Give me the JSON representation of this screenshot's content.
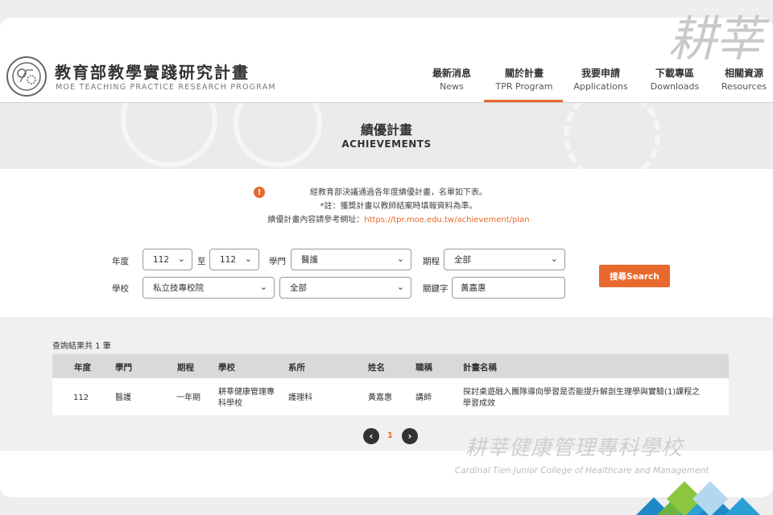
{
  "watermark_top": "耕莘",
  "logo": {
    "zh": "教育部教學實踐研究計畫",
    "en": "MOE TEACHING PRACTICE RESEARCH PROGRAM"
  },
  "nav": [
    {
      "zh": "最新消息",
      "en": "News"
    },
    {
      "zh": "關於計畫",
      "en": "TPR Program"
    },
    {
      "zh": "我要申請",
      "en": "Applications"
    },
    {
      "zh": "下載專區",
      "en": "Downloads"
    },
    {
      "zh": "相關資源",
      "en": "Resources"
    }
  ],
  "banner": {
    "zh": "績優計畫",
    "en": "ACHIEVEMENTS"
  },
  "notice": {
    "icon": "!",
    "line1": "經教育部決議通過各年度績優計畫，名單如下表。",
    "line2": "*註：獲獎計畫以教師結案時填報資料為準。",
    "line3_prefix": "績優計畫內容請參考網址：",
    "line3_link": "https://tpr.moe.edu.tw/achievement/plan"
  },
  "filters": {
    "year_label": "年度",
    "year_from": "112",
    "to_label": "至",
    "year_to": "112",
    "dept_label": "學門",
    "dept_value": "醫護",
    "term_label": "期程",
    "term_value": "全部",
    "school_label": "學校",
    "school_type": "私立技專校院",
    "school_value": "全部",
    "keyword_label": "關鍵字",
    "keyword_value": "黃嘉惠",
    "search_button": "搜尋Search"
  },
  "results": {
    "count_text": "查詢結果共 1 筆",
    "headers": [
      "年度",
      "學門",
      "期程",
      "學校",
      "系所",
      "姓名",
      "職稱",
      "計畫名稱"
    ],
    "rows": [
      {
        "year": "112",
        "dept": "醫護",
        "term": "一年期",
        "school_l1": "耕莘健康管理專",
        "school_l2": "科學校",
        "program": "護理科",
        "name": "黃嘉惠",
        "title": "講師",
        "plan_l1": "探討桌遊融入團隊導向學習是否能提升解剖生理學與實驗(1)課程之",
        "plan_l2": "學習成效"
      }
    ]
  },
  "pagination": {
    "prev": "‹",
    "page": "1",
    "next": "›"
  },
  "school_watermark": {
    "zh": "耕莘健康管理專科學校",
    "en": "Cardinal Tien Junior College of Healthcare and Management"
  }
}
